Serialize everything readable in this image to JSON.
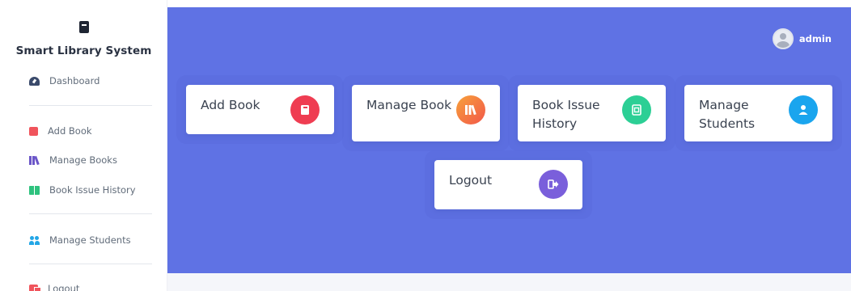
{
  "brand": {
    "title": "Smart Library System",
    "icon": "book-icon"
  },
  "sidebar": {
    "items": [
      {
        "label": "Dashboard",
        "icon": "dashboard-icon"
      },
      {
        "label": "Add Book",
        "icon": "book-icon"
      },
      {
        "label": "Manage Books",
        "icon": "books-icon"
      },
      {
        "label": "Book Issue History",
        "icon": "open-book-icon"
      },
      {
        "label": "Manage Students",
        "icon": "users-icon"
      },
      {
        "label": "Logout",
        "icon": "logout-icon"
      }
    ]
  },
  "header": {
    "user_name": "admin"
  },
  "cards": [
    {
      "label": "Add Book",
      "icon": "book-icon",
      "color": "#f5365c"
    },
    {
      "label": "Manage Book",
      "icon": "books-icon",
      "color": "#fb6340"
    },
    {
      "label": "Book Issue History",
      "icon": "notebook-icon",
      "color": "#2dce89"
    },
    {
      "label": "Manage Students",
      "icon": "user-icon",
      "color": "#11cdef"
    },
    {
      "label": "Logout",
      "icon": "logout-icon",
      "color": "#8965e0"
    }
  ],
  "colors": {
    "main_background": "#5f72e4",
    "sidebar_background": "#ffffff",
    "text_dark": "#3a4250"
  }
}
